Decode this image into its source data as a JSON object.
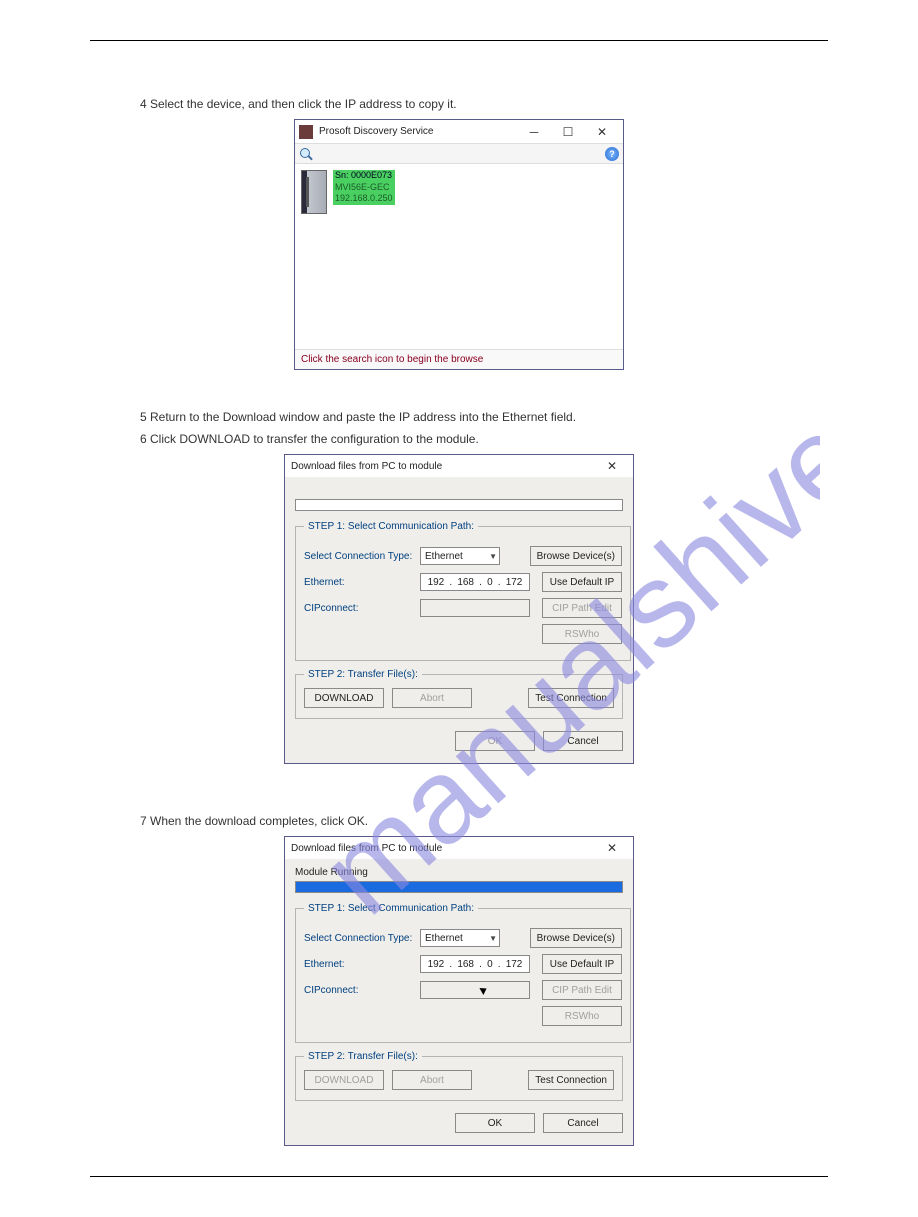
{
  "instructions": {
    "line1": "4  Select the device, and then click the IP address to copy it.",
    "line2": "5  Return to the Download window and paste the IP address into the Ethernet field.",
    "line3": "6  Click DOWNLOAD to transfer the configuration to the module.",
    "line4": "7  When the download completes, click OK."
  },
  "win1": {
    "title": "Prosoft Discovery Service",
    "help_glyph": "?",
    "device": {
      "sn": "Sn: 0000E073",
      "model": "MVI56E-GEC",
      "ip": "192.168.0.250"
    },
    "status": "Click the search icon to begin the browse"
  },
  "dlg": {
    "title": "Download files from PC to module",
    "step1_legend": "STEP 1: Select Communication Path:",
    "step2_legend": "STEP 2: Transfer File(s):",
    "labels": {
      "conn_type": "Select Connection Type:",
      "ethernet": "Ethernet:",
      "cip": "CIPconnect:"
    },
    "conn_type_value": "Ethernet",
    "ip": {
      "a": "192",
      "b": "168",
      "c": "0",
      "d": "172"
    },
    "buttons": {
      "browse": "Browse Device(s)",
      "default_ip": "Use Default IP",
      "cip_edit": "CIP Path Edit",
      "rswho": "RSWho",
      "download": "DOWNLOAD",
      "abort": "Abort",
      "test": "Test Connection",
      "ok": "OK",
      "cancel": "Cancel"
    },
    "status_running": "Module Running"
  }
}
